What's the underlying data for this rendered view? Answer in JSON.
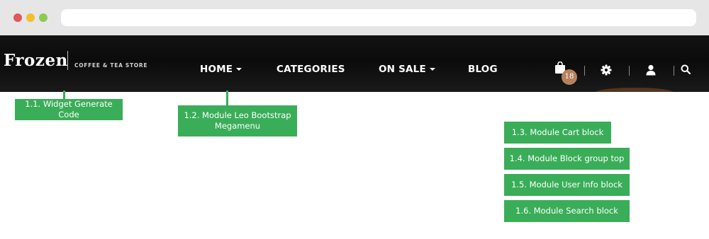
{
  "browser": {
    "traffic_lights": [
      "close",
      "minimize",
      "maximize"
    ],
    "colors": {
      "close": "#e0585a",
      "minimize": "#f3bf2f",
      "maximize": "#8ec955"
    }
  },
  "header": {
    "logo": {
      "name": "Frozen",
      "tagline": "COFFEE & TEA STORE"
    },
    "nav": {
      "home": "HOME",
      "categories": "CATEGORIES",
      "on_sale": "ON SALE",
      "blog": "BLOG"
    },
    "cart": {
      "count": "18",
      "icon": "shopping-bag-icon"
    },
    "icons": {
      "settings": "gear-icon",
      "user": "user-icon",
      "search": "search-icon"
    }
  },
  "annotations": {
    "a1": "1.1. Widget Generate Code",
    "a2_line1": "1.2. Module Leo Bootstrap",
    "a2_line2": "Megamenu",
    "a3": "1.3. Module Cart block",
    "a4": "1.4. Module Block group top",
    "a5": "1.5. Module User Info block",
    "a6": "1.6. Module Search block"
  },
  "colors": {
    "annotation": "#3aad58",
    "header_bg": "#111111",
    "badge": "#b6825c"
  }
}
